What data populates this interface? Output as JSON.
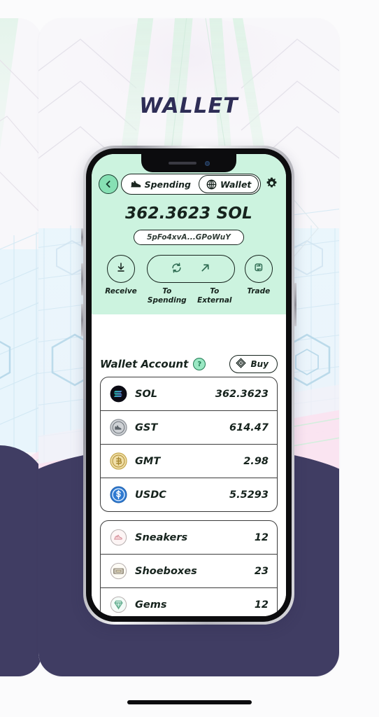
{
  "page": {
    "title": "WALLET",
    "title_color": "#2e2d56",
    "background_color": "#fbfbfc",
    "navy_color": "#403d63"
  },
  "app": {
    "accent_mint": "#ccf3df",
    "ink": "#16231d",
    "header": {
      "back_icon": "chevron-left-icon",
      "settings_icon": "gear-icon",
      "segments": [
        {
          "label": "Spending",
          "icon": "sneaker-icon",
          "active": false
        },
        {
          "label": "Wallet",
          "icon": "globe-icon",
          "active": true
        }
      ],
      "balance": "362.3623 SOL",
      "address": "5pFo4xvA...GPoWuY"
    },
    "actions": [
      {
        "label": "Receive",
        "icon": "download-arrow-icon"
      },
      {
        "label": "To Spending",
        "icon": "refresh-circle-icon"
      },
      {
        "label": "To External",
        "icon": "arrow-up-right-icon"
      },
      {
        "label": "Trade",
        "icon": "swap-repeat-icon"
      }
    ],
    "section": {
      "title": "Wallet Account",
      "help_badge": "?",
      "buy_label": "Buy",
      "buy_icon": "diamond-layers-icon"
    },
    "tokens": [
      {
        "name": "SOL",
        "value": "362.3623",
        "icon": "solana-icon"
      },
      {
        "name": "GST",
        "value": "614.47",
        "icon": "gst-coin-icon"
      },
      {
        "name": "GMT",
        "value": "2.98",
        "icon": "gmt-coin-icon"
      },
      {
        "name": "USDC",
        "value": "5.5293",
        "icon": "usdc-coin-icon"
      }
    ],
    "inventory": [
      {
        "name": "Sneakers",
        "value": "12",
        "icon": "sneaker-outline-icon"
      },
      {
        "name": "Shoeboxes",
        "value": "23",
        "icon": "shoebox-icon"
      },
      {
        "name": "Gems",
        "value": "12",
        "icon": "gem-icon"
      }
    ]
  }
}
